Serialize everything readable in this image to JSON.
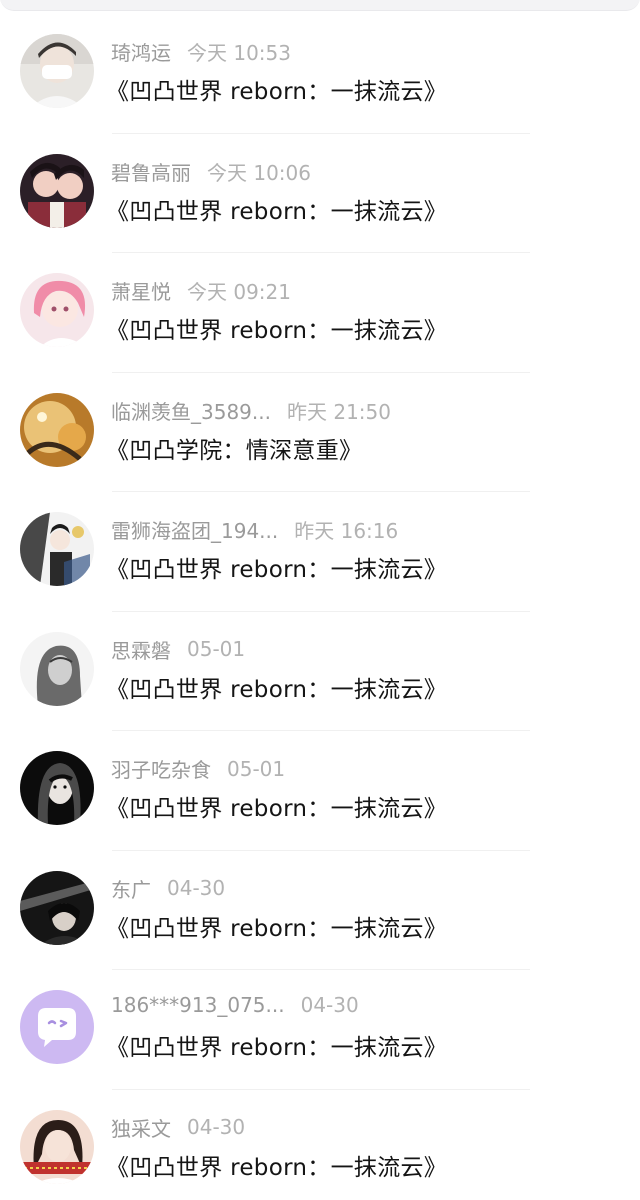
{
  "messages": [
    {
      "name": "琦鸿运",
      "time": "今天 10:53",
      "title": "《凹凸世界 reborn：一抹流云》",
      "avatar_icon": "avatar-photo-masked-person-icon",
      "colors": [
        "#e8e6e2",
        "#3a3633",
        "#ffffff"
      ]
    },
    {
      "name": "碧鲁高丽",
      "time": "今天 10:06",
      "title": "《凹凸世界 reborn：一抹流云》",
      "avatar_icon": "avatar-anime-duo-icon",
      "colors": [
        "#2b1f27",
        "#f1cfc3",
        "#8a2d3a"
      ]
    },
    {
      "name": "萧星悦",
      "time": "今天 09:21",
      "title": "《凹凸世界 reborn：一抹流云》",
      "avatar_icon": "avatar-anime-pink-hair-icon",
      "colors": [
        "#f6e6ea",
        "#f08ca8",
        "#ffffff"
      ]
    },
    {
      "name": "临渊羡鱼_3589...",
      "time": "昨天 21:50",
      "title": "《凹凸学院：情深意重》",
      "avatar_icon": "avatar-golden-art-icon",
      "colors": [
        "#b87a2a",
        "#f6d58a",
        "#3a2a1a"
      ]
    },
    {
      "name": "雷狮海盗团_194...",
      "time": "昨天 16:16",
      "title": "《凹凸世界 reborn：一抹流云》",
      "avatar_icon": "avatar-anime-group-icon",
      "colors": [
        "#f2f2f2",
        "#2a2a2a",
        "#e7c86a"
      ]
    },
    {
      "name": "思霖磐",
      "time": "05-01",
      "title": "《凹凸世界 reborn：一抹流云》",
      "avatar_icon": "avatar-sketch-girl-icon",
      "colors": [
        "#f4f4f4",
        "#6a6a6a",
        "#cfcfcf"
      ]
    },
    {
      "name": "羽子吃杂食",
      "time": "05-01",
      "title": "《凹凸世界 reborn：一抹流云》",
      "avatar_icon": "avatar-dark-girl-icon",
      "colors": [
        "#0c0c0c",
        "#e9e4e0",
        "#4a4a4a"
      ]
    },
    {
      "name": "东广",
      "time": "04-30",
      "title": "《凹凸世界 reborn：一抹流云》",
      "avatar_icon": "avatar-night-photo-icon",
      "colors": [
        "#151515",
        "#8a8a8a",
        "#d8d0c8"
      ]
    },
    {
      "name": "186***913_075...",
      "time": "04-30",
      "title": "《凹凸世界 reborn：一抹流云》",
      "avatar_icon": "avatar-default-chat-bubble-icon",
      "colors": [
        "#cdb9f2",
        "#ffffff",
        "#a88fe0"
      ]
    },
    {
      "name": "独采文",
      "time": "04-30",
      "title": "《凹凸世界 reborn：一抹流云》",
      "avatar_icon": "avatar-selfie-photo-icon",
      "colors": [
        "#f3ddd2",
        "#2b1d18",
        "#c0322e"
      ]
    }
  ]
}
